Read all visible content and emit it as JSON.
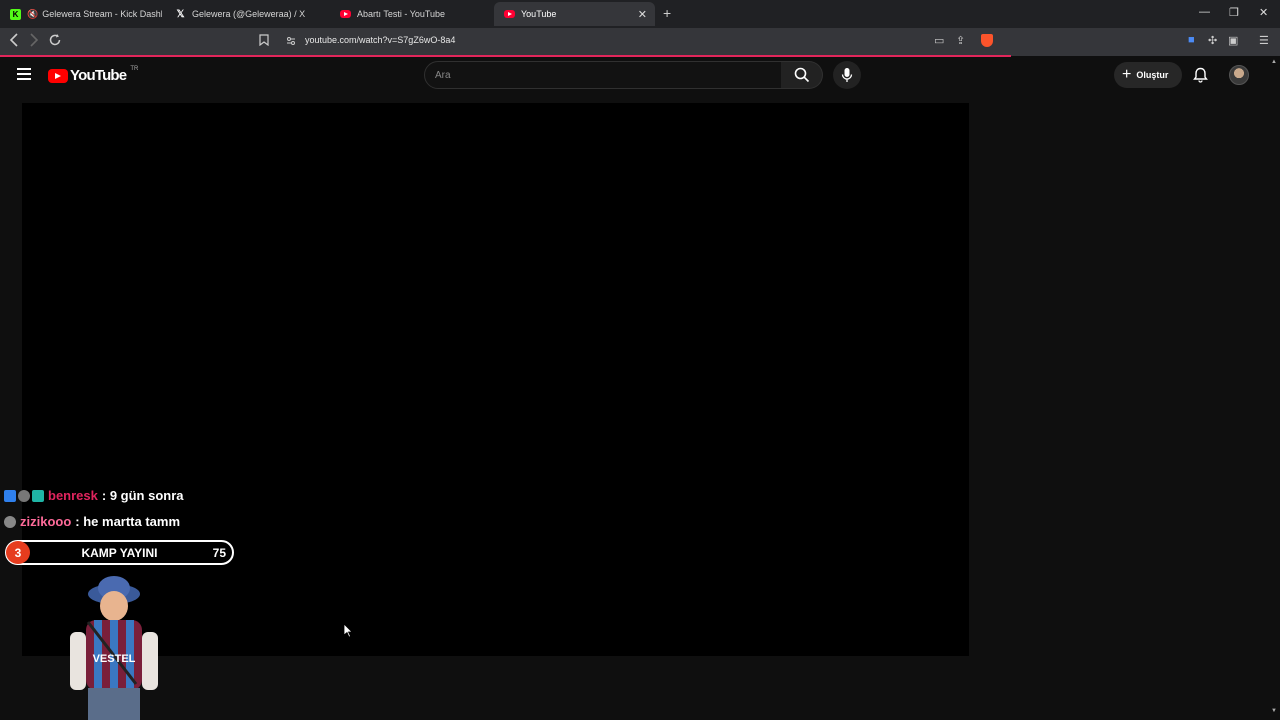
{
  "browser": {
    "tabs": [
      {
        "title": "Gelewera Stream - Kick Dashboar",
        "icon": "kick-icon",
        "muted": true
      },
      {
        "title": "Gelewera (@Geleweraa) / X",
        "icon": "x-icon"
      },
      {
        "title": "Abartı Testi - YouTube",
        "icon": "youtube-icon"
      },
      {
        "title": "YouTube",
        "icon": "youtube-icon",
        "active": true
      }
    ],
    "url": "youtube.com/watch?v=S7gZ6wO-8a4",
    "page_load_progress": 0.79
  },
  "youtube": {
    "logo_text": "YouTube",
    "country_code": "TR",
    "search_placeholder": "Ara",
    "create_label": "Oluştur"
  },
  "overlay": {
    "chat": [
      {
        "user": "benresk",
        "user_color": "#e0245e",
        "message": ": 9 gün sonra"
      },
      {
        "user": "zizikooo",
        "user_color": "#ff6b9a",
        "message": ": he martta tamm"
      }
    ],
    "goal": {
      "level": "3",
      "label": "KAMP YAYINI",
      "count": "75"
    },
    "kid_shirt_text": "VESTEL"
  },
  "colors": {
    "accent_progress": "#e2265b",
    "youtube_red": "#ff0000",
    "kick_green": "#53fc18"
  }
}
